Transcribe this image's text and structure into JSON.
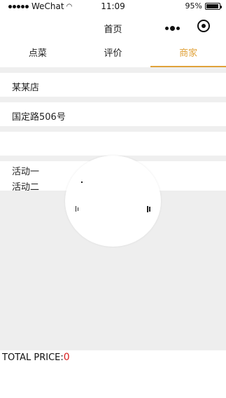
{
  "status_bar": {
    "carrier": "WeChat",
    "time": "11:09",
    "battery": "95%",
    "battery_level": 0.95
  },
  "nav": {
    "title": "首页"
  },
  "tabs": [
    {
      "label": "点菜",
      "active": false
    },
    {
      "label": "评价",
      "active": false
    },
    {
      "label": "商家",
      "active": true
    }
  ],
  "shop": {
    "name": "某某店",
    "address": "国定路506号",
    "promotions": [
      "活动一",
      "活动二"
    ]
  },
  "footer": {
    "total_label": "TOTAL PRICE:",
    "total_value": "0"
  },
  "colors": {
    "accent": "#e0a23a",
    "price": "#d81e1e",
    "divider": "#efefef"
  }
}
